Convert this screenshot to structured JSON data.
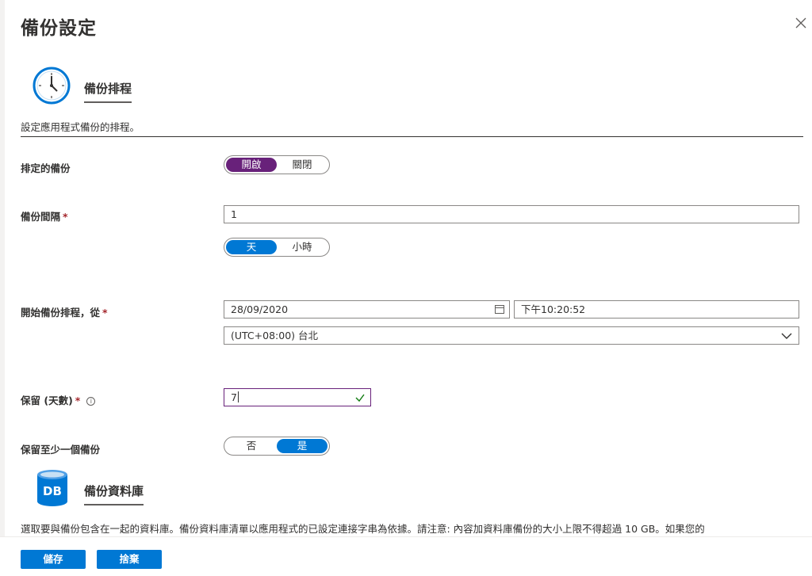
{
  "panel": {
    "title": "備份設定",
    "close_icon": "close-icon"
  },
  "schedule_section": {
    "icon": "clock-icon",
    "title": "備份排程",
    "description": "設定應用程式備份的排程。"
  },
  "scheduled_backup": {
    "label": "排定的備份",
    "options": [
      "開啟",
      "關閉"
    ],
    "selected": "開啟"
  },
  "backup_interval": {
    "label": "備份間隔",
    "required_mark": "*",
    "value": "1",
    "units": [
      "天",
      "小時"
    ],
    "selected_unit": "天"
  },
  "start_schedule": {
    "label": "開始備份排程，從",
    "required_mark": "*",
    "date": "28/09/2020",
    "time": "下午10:20:52",
    "timezone": "(UTC+08:00) 台北"
  },
  "retention": {
    "label": "保留 (天數)",
    "required_mark": "*",
    "info_icon": "i",
    "value": "7"
  },
  "keep_one": {
    "label": "保留至少一個備份",
    "options": [
      "否",
      "是"
    ],
    "selected": "是"
  },
  "database_section": {
    "icon": "database-icon",
    "icon_text": "DB",
    "title": "備份資料庫",
    "description": "選取要與備份包含在一起的資料庫。備份資料庫清單以應用程式的已設定連接字串為依據。請注意: 內容加資料庫備份的大小上限不得超過 10 GB。如果您的"
  },
  "footer": {
    "save_label": "儲存",
    "discard_label": "捨棄"
  },
  "colors": {
    "accent_purple": "#68217a",
    "accent_blue": "#0078d4",
    "required_red": "#a4262c"
  }
}
